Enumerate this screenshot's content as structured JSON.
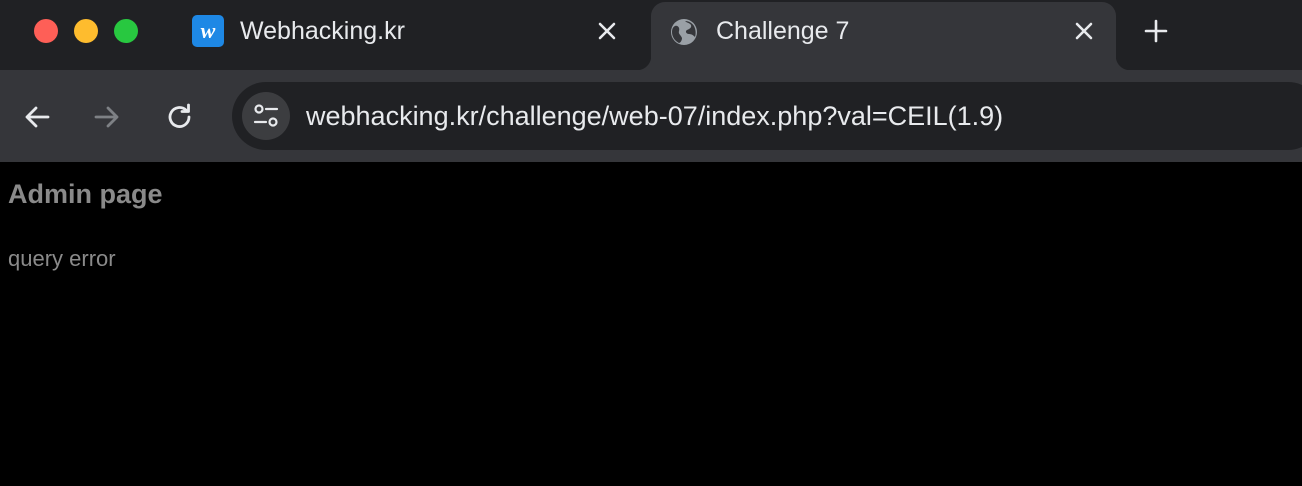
{
  "tabs": [
    {
      "title": "Webhacking.kr",
      "favicon": "w-logo-icon",
      "favicon_letter": "w",
      "active": false
    },
    {
      "title": "Challenge 7",
      "favicon": "globe-icon",
      "active": true
    }
  ],
  "toolbar": {
    "url": "webhacking.kr/challenge/web-07/index.php?val=CEIL(1.9)"
  },
  "page": {
    "heading": "Admin page",
    "message": "query error"
  },
  "colors": {
    "tabstrip": "#202124",
    "toolbar": "#35363a",
    "page_background": "#000000",
    "page_text": "#8a8a8a",
    "traffic_close": "#fe5f57",
    "traffic_minimize": "#febc2e",
    "traffic_maximize": "#28c840"
  }
}
